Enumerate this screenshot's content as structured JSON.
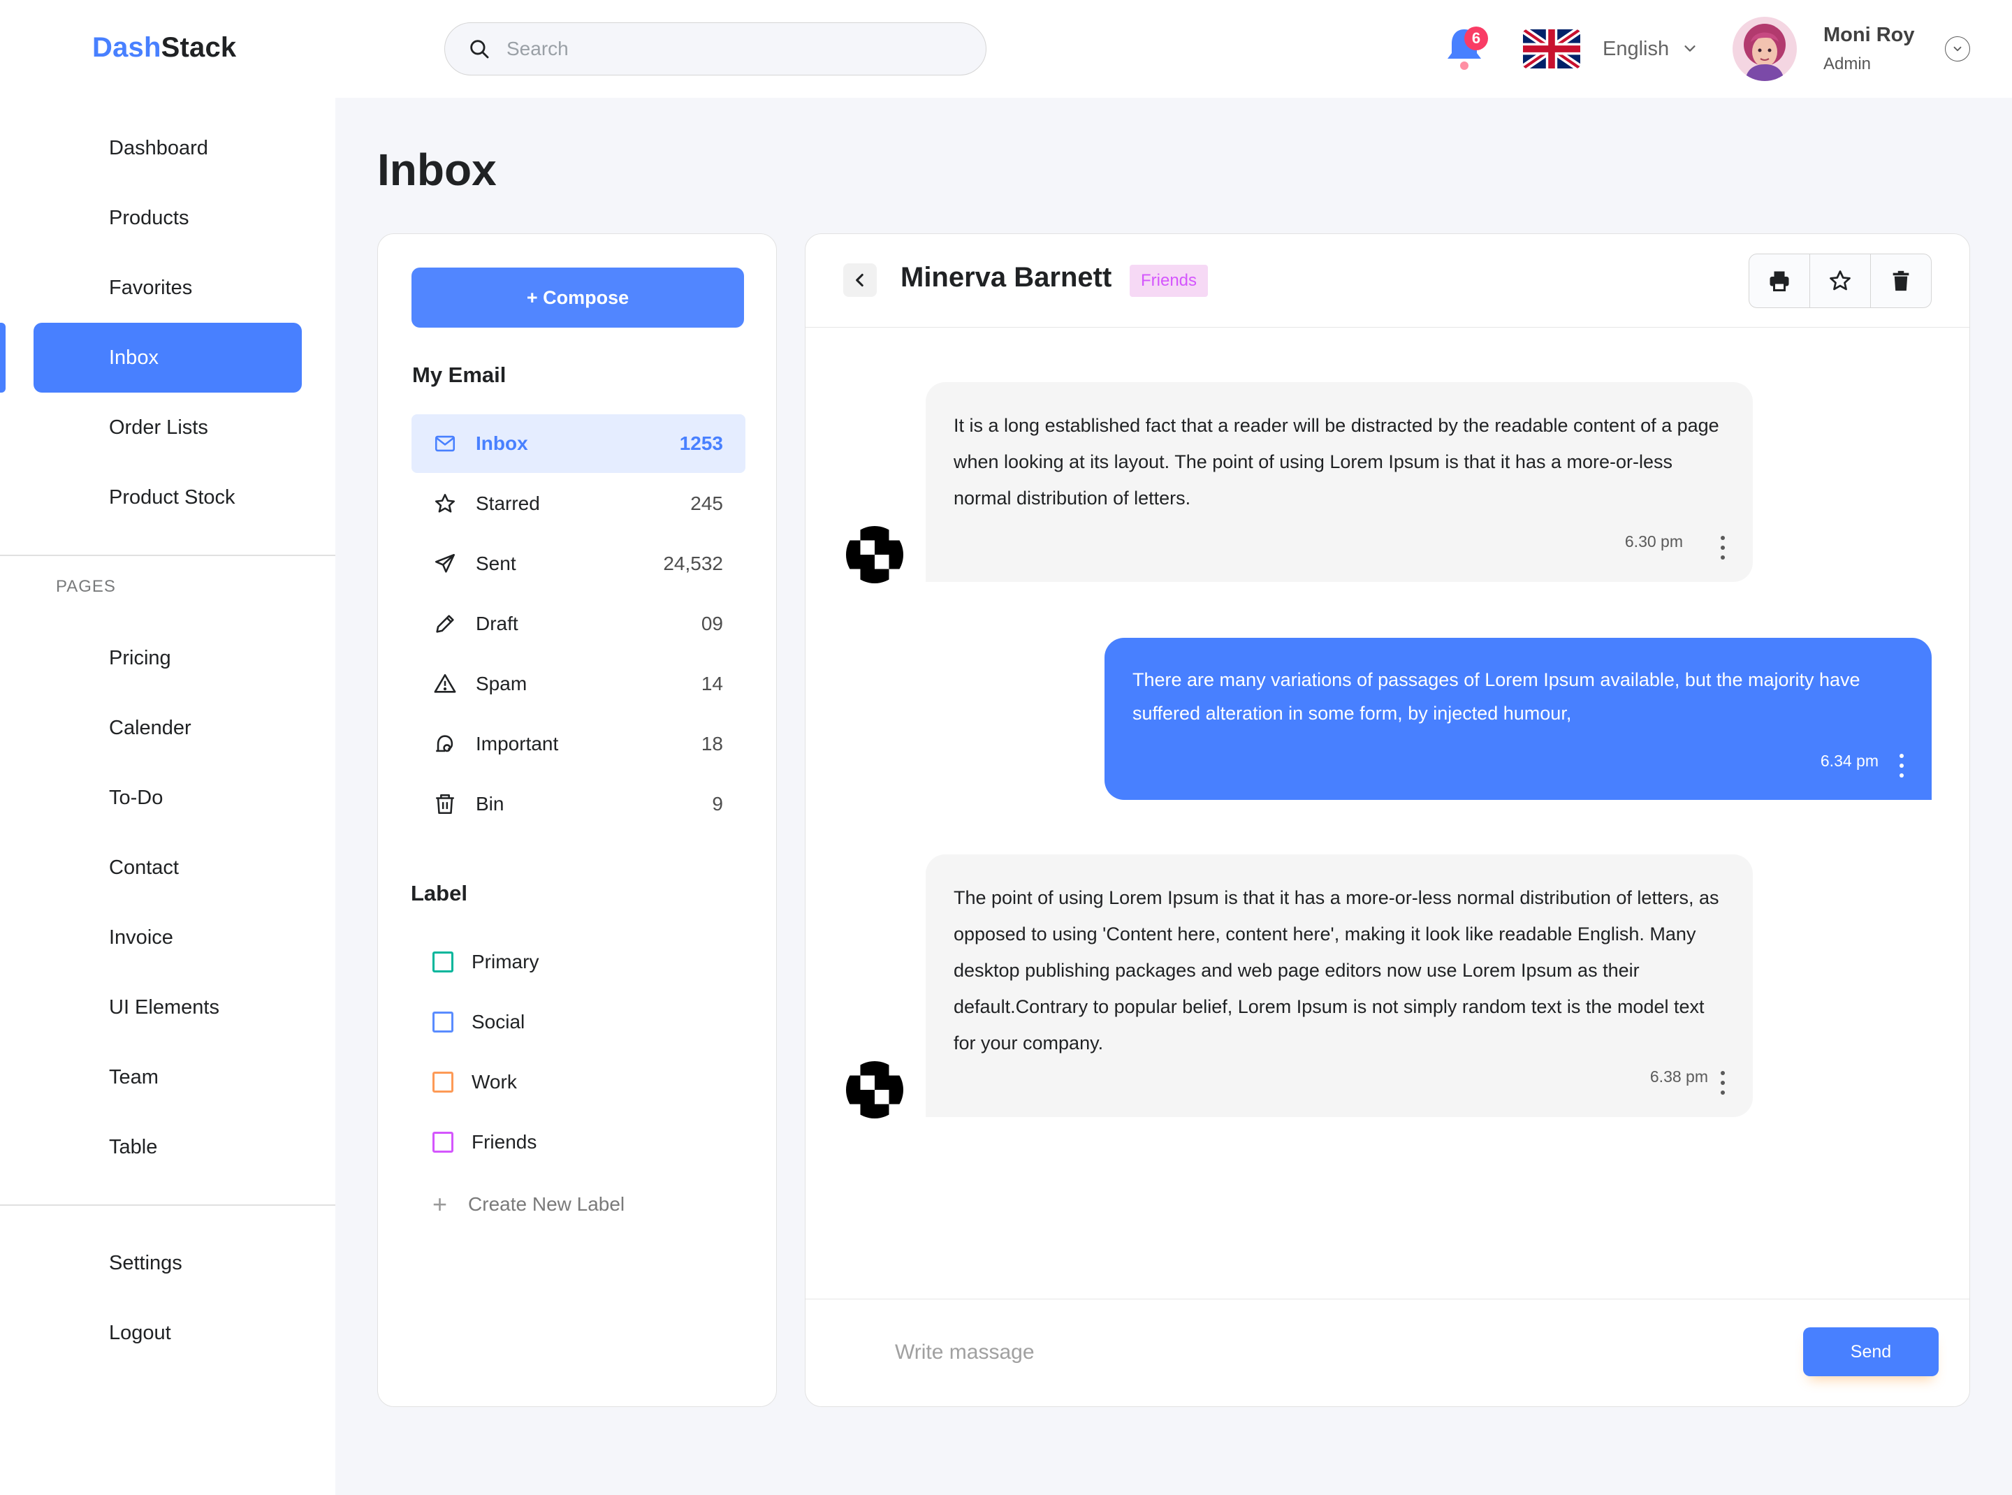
{
  "brand": {
    "part1": "Dash",
    "part2": "Stack"
  },
  "search": {
    "placeholder": "Search"
  },
  "notifications": {
    "count": "6"
  },
  "language": {
    "label": "English",
    "flag_icon": "uk-flag-icon"
  },
  "user": {
    "name": "Moni Roy",
    "role": "Admin"
  },
  "sidebar": {
    "main_items": [
      {
        "label": "Dashboard"
      },
      {
        "label": "Products"
      },
      {
        "label": "Favorites"
      },
      {
        "label": "Inbox",
        "active": true
      },
      {
        "label": "Order Lists"
      },
      {
        "label": "Product Stock"
      }
    ],
    "pages_title": "PAGES",
    "pages_items": [
      {
        "label": "Pricing"
      },
      {
        "label": "Calender"
      },
      {
        "label": "To-Do"
      },
      {
        "label": "Contact"
      },
      {
        "label": "Invoice"
      },
      {
        "label": "UI Elements"
      },
      {
        "label": "Team"
      },
      {
        "label": "Table"
      }
    ],
    "bottom_items": [
      {
        "label": "Settings"
      },
      {
        "label": "Logout"
      }
    ]
  },
  "page": {
    "title": "Inbox"
  },
  "mail": {
    "compose_label": "+ Compose",
    "my_email_title": "My Email",
    "folders": [
      {
        "label": "Inbox",
        "count": "1253",
        "icon": "mail-icon",
        "active": true
      },
      {
        "label": "Starred",
        "count": "245",
        "icon": "star-icon"
      },
      {
        "label": "Sent",
        "count": "24,532",
        "icon": "send-icon"
      },
      {
        "label": "Draft",
        "count": "09",
        "icon": "pencil-icon"
      },
      {
        "label": "Spam",
        "count": "14",
        "icon": "warning-icon"
      },
      {
        "label": "Important",
        "count": "18",
        "icon": "important-icon"
      },
      {
        "label": "Bin",
        "count": "9",
        "icon": "trash-icon"
      }
    ],
    "label_title": "Label",
    "labels": [
      {
        "label": "Primary",
        "color": "#00b69b"
      },
      {
        "label": "Social",
        "color": "#5a8cff"
      },
      {
        "label": "Work",
        "color": "#fd9a56"
      },
      {
        "label": "Friends",
        "color": "#d456fd"
      }
    ],
    "create_label": "Create New Label"
  },
  "chat": {
    "contact_name": "Minerva Barnett",
    "contact_tag": "Friends",
    "messages": [
      {
        "direction": "in",
        "text": "It is a long established fact that a reader will be distracted by the readable content of a page when looking at its layout. The point of using Lorem Ipsum is that it has a more-or-less normal distribution of letters.",
        "time": "6.30 pm"
      },
      {
        "direction": "out",
        "text": "There are many variations of passages of Lorem Ipsum available, but the majority have suffered alteration in some form, by injected humour,",
        "time": "6.34 pm"
      },
      {
        "direction": "in",
        "text": "The point of using Lorem Ipsum is that it has a more-or-less normal distribution of letters, as opposed to using 'Content here, content here', making it look like readable English. Many desktop publishing packages and web page editors now use Lorem Ipsum as their default.Contrary to popular belief, Lorem Ipsum is not simply random text is the model text for your company.",
        "time": "6.38 pm"
      }
    ],
    "input_placeholder": "Write massage",
    "send_label": "Send"
  },
  "colors": {
    "accent": "#4880ff",
    "badge": "#f93c65",
    "friends_tag_bg": "#f6d9f5",
    "friends_tag_text": "#d456fd"
  }
}
